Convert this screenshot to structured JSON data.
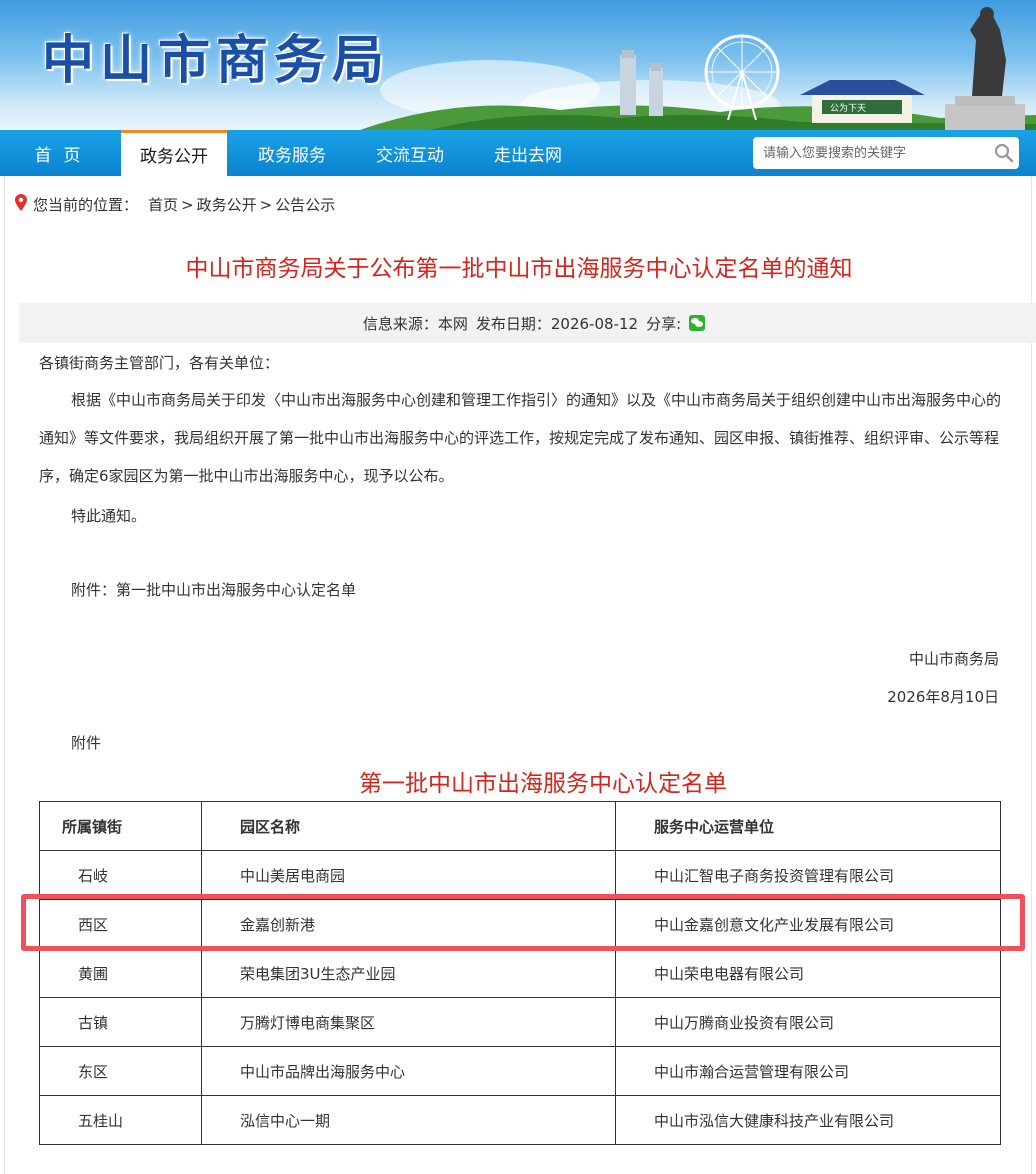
{
  "header": {
    "site_title": "中山市商务局"
  },
  "nav": {
    "items": [
      {
        "label": "首页",
        "active": false
      },
      {
        "label": "政务公开",
        "active": true
      },
      {
        "label": "政务服务",
        "active": false
      },
      {
        "label": "交流互动",
        "active": false
      },
      {
        "label": "走出去网",
        "active": false
      }
    ],
    "search_placeholder": "请输入您要搜索的关键字"
  },
  "breadcrumb": {
    "prefix": "您当前的位置：",
    "items": [
      "首页",
      "政务公开",
      "公告公示"
    ],
    "sep": ">"
  },
  "article": {
    "title": "中山市商务局关于公布第一批中山市出海服务中心认定名单的通知",
    "source_label": "信息来源：本网",
    "date_label": "发布日期：2026-08-12",
    "share_label": "分享:",
    "salutation": "各镇街商务主管部门，各有关单位：",
    "paragraph": "根据《中山市商务局关于印发〈中山市出海服务中心创建和管理工作指引〉的通知》以及《中山市商务局关于组织创建中山市出海服务中心的通知》等文件要求，我局组织开展了第一批中山市出海服务中心的评选工作，按规定完成了发布通知、园区申报、镇街推荐、组织评审、公示等程序，确定6家园区为第一批中山市出海服务中心，现予以公布。",
    "closing": "特此通知。",
    "attachment": "附件：第一批中山市出海服务中心认定名单",
    "signer": "中山市商务局",
    "sign_date": "2026年8月10日",
    "attachment_heading": "附件"
  },
  "list": {
    "title": "第一批中山市出海服务中心认定名单",
    "headers": [
      "所属镇街",
      "园区名称",
      "服务中心运营单位"
    ],
    "rows": [
      [
        "石岐",
        "中山美居电商园",
        "中山汇智电子商务投资管理有限公司"
      ],
      [
        "西区",
        "金嘉创新港",
        "中山金嘉创意文化产业发展有限公司"
      ],
      [
        "黄圃",
        "荣电集团3U生态产业园",
        "中山荣电电器有限公司"
      ],
      [
        "古镇",
        "万腾灯博电商集聚区",
        "中山万腾商业投资有限公司"
      ],
      [
        "东区",
        "中山市品牌出海服务中心",
        "中山市瀚合运营管理有限公司"
      ],
      [
        "五桂山",
        "泓信中心一期",
        "中山市泓信大健康科技产业有限公司"
      ]
    ],
    "highlighted_row": 1
  },
  "colors": {
    "title_red": "#d8241c",
    "nav_blue": "#0a83cf",
    "highlight": "#f0505a"
  }
}
